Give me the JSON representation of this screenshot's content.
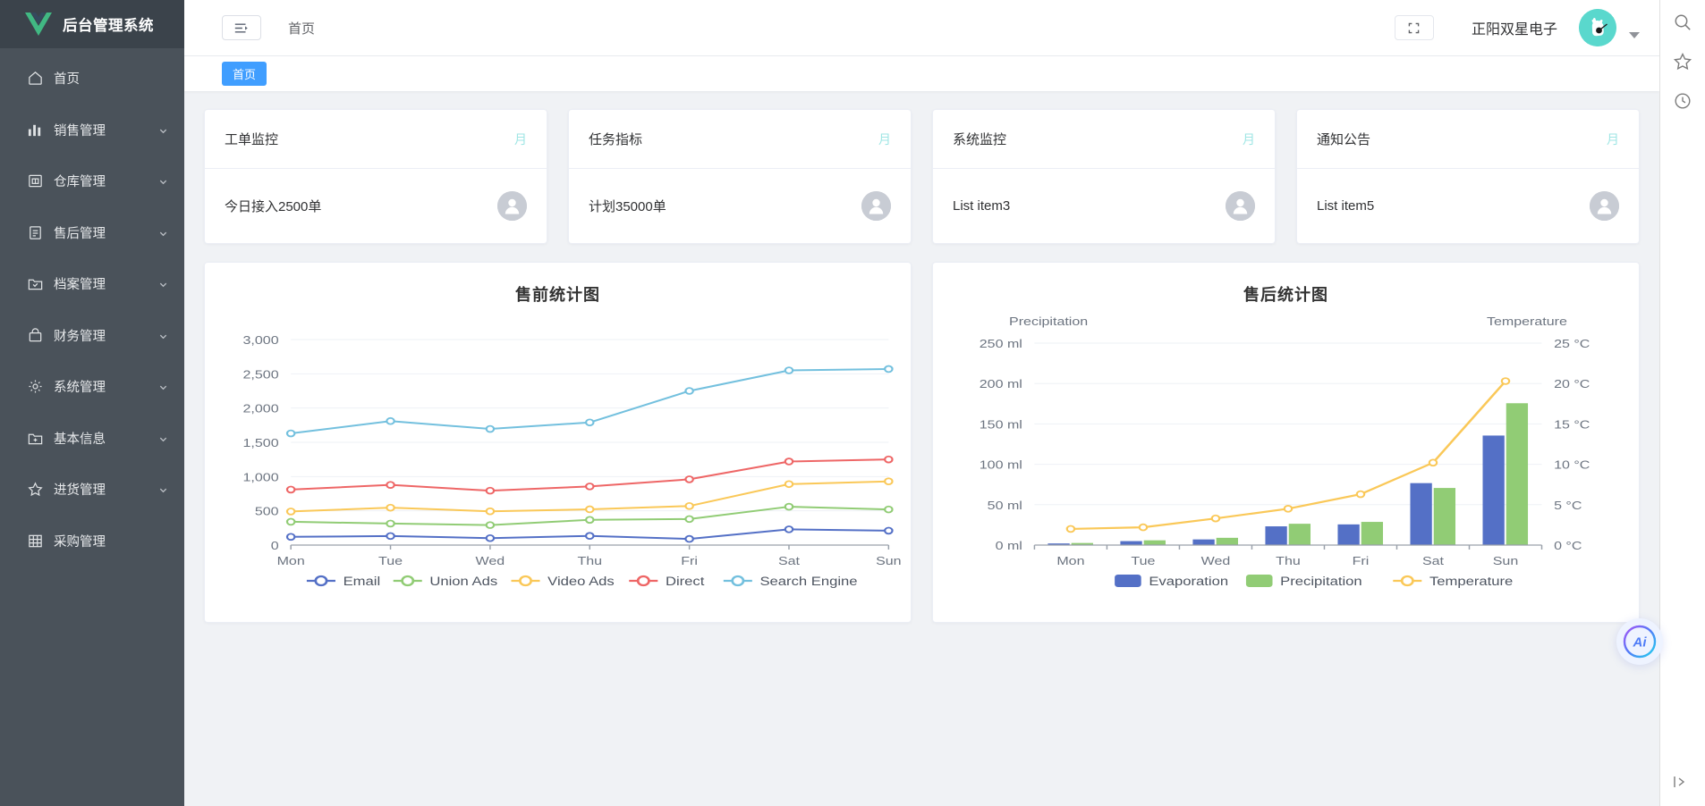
{
  "brand": {
    "title": "后台管理系统",
    "logo_icon": "vue-logo-icon",
    "logo_color": "#41b883"
  },
  "sidebar": {
    "items": [
      {
        "label": "首页",
        "icon": "home-icon",
        "has_chevron": false
      },
      {
        "label": "销售管理",
        "icon": "bar-chart-icon",
        "has_chevron": true
      },
      {
        "label": "仓库管理",
        "icon": "warehouse-icon",
        "has_chevron": true
      },
      {
        "label": "售后管理",
        "icon": "document-icon",
        "has_chevron": true
      },
      {
        "label": "档案管理",
        "icon": "folder-checked-icon",
        "has_chevron": true
      },
      {
        "label": "财务管理",
        "icon": "briefcase-icon",
        "has_chevron": true
      },
      {
        "label": "系统管理",
        "icon": "gear-icon",
        "has_chevron": true
      },
      {
        "label": "基本信息",
        "icon": "folder-add-icon",
        "has_chevron": true
      },
      {
        "label": "进货管理",
        "icon": "star-icon",
        "has_chevron": true
      },
      {
        "label": "采购管理",
        "icon": "grid-icon",
        "has_chevron": false
      }
    ]
  },
  "topbar": {
    "hamburger_icon": "menu-fold-icon",
    "breadcrumb": "首页",
    "fullscreen_icon": "fullscreen-icon",
    "username": "正阳双星电子",
    "avatar_icon": "user-avatar-icon",
    "caret_icon": "chevron-down-icon"
  },
  "tagbar": {
    "tags": [
      {
        "label": "首页",
        "active": true
      }
    ]
  },
  "stat_cards": [
    {
      "title": "工单监控",
      "link": "月",
      "text": "今日接入2500单",
      "avatar_icon": "person-icon"
    },
    {
      "title": "任务指标",
      "link": "月",
      "text": "计划35000单",
      "avatar_icon": "person-icon"
    },
    {
      "title": "系统监控",
      "link": "月",
      "text": "List item3",
      "avatar_icon": "person-icon"
    },
    {
      "title": "通知公告",
      "link": "月",
      "text": "List item5",
      "avatar_icon": "person-icon"
    }
  ],
  "colors": {
    "accent": "#409eff",
    "sidebar_bg": "#4a525a",
    "logo_bg": "#3b434b",
    "avatar_bg": "#5ad8cd",
    "card_link": "#9ee6e4"
  },
  "chart_data": [
    {
      "type": "line",
      "title": "售前统计图",
      "categories": [
        "Mon",
        "Tue",
        "Wed",
        "Thu",
        "Fri",
        "Sat",
        "Sun"
      ],
      "xlabel": "",
      "ylabel": "",
      "ylim": [
        0,
        3000
      ],
      "yticks": [
        "0",
        "500",
        "1,000",
        "1,500",
        "2,000",
        "2,500",
        "3,000"
      ],
      "grid": true,
      "legend_position": "bottom",
      "series": [
        {
          "name": "Email",
          "color": "#5470c6",
          "values": [
            120,
            132,
            101,
            134,
            90,
            230,
            210
          ]
        },
        {
          "name": "Union Ads",
          "color": "#91cc75",
          "values": [
            220,
            182,
            191,
            234,
            290,
            330,
            310
          ]
        },
        {
          "name": "Video Ads",
          "color": "#fac858",
          "values": [
            150,
            232,
            201,
            154,
            190,
            330,
            410
          ]
        },
        {
          "name": "Direct",
          "color": "#ee6666",
          "values": [
            320,
            332,
            301,
            334,
            390,
            330,
            320
          ]
        },
        {
          "name": "Search Engine",
          "color": "#73c0de",
          "values": [
            820,
            932,
            901,
            934,
            1290,
            1330,
            1320
          ]
        }
      ],
      "stacked": true
    },
    {
      "type": "bar",
      "title": "售后统计图",
      "categories": [
        "Mon",
        "Tue",
        "Wed",
        "Thu",
        "Fri",
        "Sat",
        "Sun"
      ],
      "left_axis_name": "Precipitation",
      "right_axis_name": "Temperature",
      "left_ticks": [
        "0 ml",
        "50 ml",
        "100 ml",
        "150 ml",
        "200 ml",
        "250 ml"
      ],
      "right_ticks": [
        "0 °C",
        "5 °C",
        "10 °C",
        "15 °C",
        "20 °C",
        "25 °C"
      ],
      "ylim": [
        0,
        250
      ],
      "y2lim": [
        0,
        25
      ],
      "grid": true,
      "legend_position": "bottom",
      "series": [
        {
          "name": "Evaporation",
          "type": "bar",
          "color": "#5470c6",
          "axis": "left",
          "values": [
            2.0,
            4.9,
            7.0,
            23.2,
            25.6,
            76.7,
            135.6
          ]
        },
        {
          "name": "Precipitation",
          "type": "bar",
          "color": "#91cc75",
          "axis": "left",
          "values": [
            2.6,
            5.9,
            9.0,
            26.4,
            28.7,
            70.7,
            175.6
          ]
        },
        {
          "name": "Temperature",
          "type": "line",
          "color": "#fac858",
          "axis": "right",
          "values": [
            2.0,
            2.2,
            3.3,
            4.5,
            6.3,
            10.2,
            20.3
          ]
        }
      ]
    }
  ],
  "browser_rail": {
    "icons": [
      "search-icon",
      "bookmark-star-icon",
      "history-clock-icon"
    ],
    "bottom_icon": "expand-panel-icon"
  },
  "ai_fab": {
    "label": "Ai",
    "icon": "ai-assistant-icon"
  }
}
